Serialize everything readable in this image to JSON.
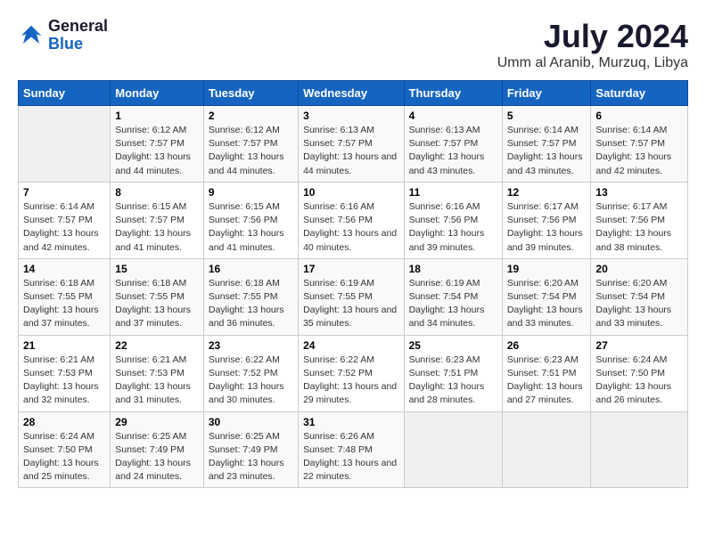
{
  "logo": {
    "line1": "General",
    "line2": "Blue"
  },
  "title": "July 2024",
  "subtitle": "Umm al Aranib, Murzuq, Libya",
  "days_of_week": [
    "Sunday",
    "Monday",
    "Tuesday",
    "Wednesday",
    "Thursday",
    "Friday",
    "Saturday"
  ],
  "weeks": [
    [
      {
        "day": "",
        "sunrise": "",
        "sunset": "",
        "daylight": ""
      },
      {
        "day": "1",
        "sunrise": "6:12 AM",
        "sunset": "7:57 PM",
        "daylight": "13 hours and 44 minutes."
      },
      {
        "day": "2",
        "sunrise": "6:12 AM",
        "sunset": "7:57 PM",
        "daylight": "13 hours and 44 minutes."
      },
      {
        "day": "3",
        "sunrise": "6:13 AM",
        "sunset": "7:57 PM",
        "daylight": "13 hours and 44 minutes."
      },
      {
        "day": "4",
        "sunrise": "6:13 AM",
        "sunset": "7:57 PM",
        "daylight": "13 hours and 43 minutes."
      },
      {
        "day": "5",
        "sunrise": "6:14 AM",
        "sunset": "7:57 PM",
        "daylight": "13 hours and 43 minutes."
      },
      {
        "day": "6",
        "sunrise": "6:14 AM",
        "sunset": "7:57 PM",
        "daylight": "13 hours and 42 minutes."
      }
    ],
    [
      {
        "day": "7",
        "sunrise": "6:14 AM",
        "sunset": "7:57 PM",
        "daylight": "13 hours and 42 minutes."
      },
      {
        "day": "8",
        "sunrise": "6:15 AM",
        "sunset": "7:57 PM",
        "daylight": "13 hours and 41 minutes."
      },
      {
        "day": "9",
        "sunrise": "6:15 AM",
        "sunset": "7:56 PM",
        "daylight": "13 hours and 41 minutes."
      },
      {
        "day": "10",
        "sunrise": "6:16 AM",
        "sunset": "7:56 PM",
        "daylight": "13 hours and 40 minutes."
      },
      {
        "day": "11",
        "sunrise": "6:16 AM",
        "sunset": "7:56 PM",
        "daylight": "13 hours and 39 minutes."
      },
      {
        "day": "12",
        "sunrise": "6:17 AM",
        "sunset": "7:56 PM",
        "daylight": "13 hours and 39 minutes."
      },
      {
        "day": "13",
        "sunrise": "6:17 AM",
        "sunset": "7:56 PM",
        "daylight": "13 hours and 38 minutes."
      }
    ],
    [
      {
        "day": "14",
        "sunrise": "6:18 AM",
        "sunset": "7:55 PM",
        "daylight": "13 hours and 37 minutes."
      },
      {
        "day": "15",
        "sunrise": "6:18 AM",
        "sunset": "7:55 PM",
        "daylight": "13 hours and 37 minutes."
      },
      {
        "day": "16",
        "sunrise": "6:18 AM",
        "sunset": "7:55 PM",
        "daylight": "13 hours and 36 minutes."
      },
      {
        "day": "17",
        "sunrise": "6:19 AM",
        "sunset": "7:55 PM",
        "daylight": "13 hours and 35 minutes."
      },
      {
        "day": "18",
        "sunrise": "6:19 AM",
        "sunset": "7:54 PM",
        "daylight": "13 hours and 34 minutes."
      },
      {
        "day": "19",
        "sunrise": "6:20 AM",
        "sunset": "7:54 PM",
        "daylight": "13 hours and 33 minutes."
      },
      {
        "day": "20",
        "sunrise": "6:20 AM",
        "sunset": "7:54 PM",
        "daylight": "13 hours and 33 minutes."
      }
    ],
    [
      {
        "day": "21",
        "sunrise": "6:21 AM",
        "sunset": "7:53 PM",
        "daylight": "13 hours and 32 minutes."
      },
      {
        "day": "22",
        "sunrise": "6:21 AM",
        "sunset": "7:53 PM",
        "daylight": "13 hours and 31 minutes."
      },
      {
        "day": "23",
        "sunrise": "6:22 AM",
        "sunset": "7:52 PM",
        "daylight": "13 hours and 30 minutes."
      },
      {
        "day": "24",
        "sunrise": "6:22 AM",
        "sunset": "7:52 PM",
        "daylight": "13 hours and 29 minutes."
      },
      {
        "day": "25",
        "sunrise": "6:23 AM",
        "sunset": "7:51 PM",
        "daylight": "13 hours and 28 minutes."
      },
      {
        "day": "26",
        "sunrise": "6:23 AM",
        "sunset": "7:51 PM",
        "daylight": "13 hours and 27 minutes."
      },
      {
        "day": "27",
        "sunrise": "6:24 AM",
        "sunset": "7:50 PM",
        "daylight": "13 hours and 26 minutes."
      }
    ],
    [
      {
        "day": "28",
        "sunrise": "6:24 AM",
        "sunset": "7:50 PM",
        "daylight": "13 hours and 25 minutes."
      },
      {
        "day": "29",
        "sunrise": "6:25 AM",
        "sunset": "7:49 PM",
        "daylight": "13 hours and 24 minutes."
      },
      {
        "day": "30",
        "sunrise": "6:25 AM",
        "sunset": "7:49 PM",
        "daylight": "13 hours and 23 minutes."
      },
      {
        "day": "31",
        "sunrise": "6:26 AM",
        "sunset": "7:48 PM",
        "daylight": "13 hours and 22 minutes."
      },
      {
        "day": "",
        "sunrise": "",
        "sunset": "",
        "daylight": ""
      },
      {
        "day": "",
        "sunrise": "",
        "sunset": "",
        "daylight": ""
      },
      {
        "day": "",
        "sunrise": "",
        "sunset": "",
        "daylight": ""
      }
    ]
  ]
}
